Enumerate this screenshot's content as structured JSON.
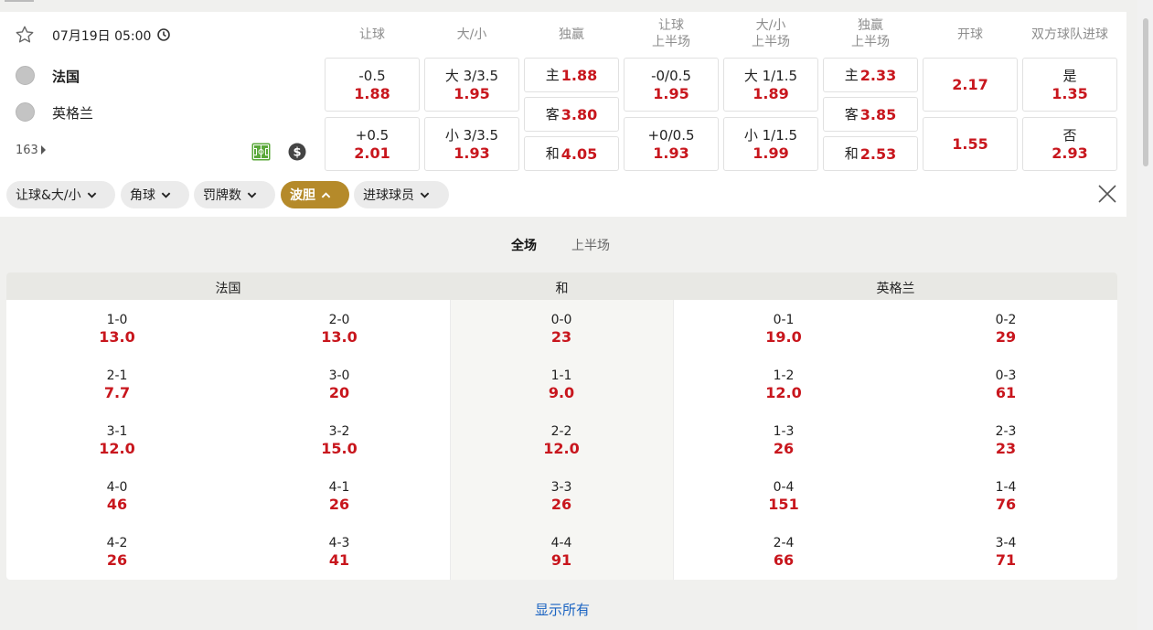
{
  "match": {
    "datetime": "07月19日 05:00",
    "home": "法国",
    "away": "英格兰",
    "more_count": "163"
  },
  "headers": [
    {
      "l1": "让球",
      "l2": ""
    },
    {
      "l1": "大/小",
      "l2": ""
    },
    {
      "l1": "独赢",
      "l2": ""
    },
    {
      "l1": "让球",
      "l2": "上半场"
    },
    {
      "l1": "大/小",
      "l2": "上半场"
    },
    {
      "l1": "独赢",
      "l2": "上半场"
    },
    {
      "l1": "开球",
      "l2": ""
    },
    {
      "l1": "双方球队进球",
      "l2": ""
    }
  ],
  "odds": {
    "handicap": [
      {
        "line": "-0.5",
        "odd": "1.88"
      },
      {
        "line": "+0.5",
        "odd": "2.01"
      }
    ],
    "over_under": [
      {
        "line": "大 3/3.5",
        "odd": "1.95"
      },
      {
        "line": "小 3/3.5",
        "odd": "1.93"
      }
    ],
    "moneyline": [
      {
        "label": "主",
        "odd": "1.88"
      },
      {
        "label": "客",
        "odd": "3.80"
      },
      {
        "label": "和",
        "odd": "4.05"
      }
    ],
    "handicap_1h": [
      {
        "line": "-0/0.5",
        "odd": "1.95"
      },
      {
        "line": "+0/0.5",
        "odd": "1.93"
      }
    ],
    "over_under_1h": [
      {
        "line": "大 1/1.5",
        "odd": "1.89"
      },
      {
        "line": "小 1/1.5",
        "odd": "1.99"
      }
    ],
    "moneyline_1h": [
      {
        "label": "主",
        "odd": "2.33"
      },
      {
        "label": "客",
        "odd": "3.85"
      },
      {
        "label": "和",
        "odd": "2.53"
      }
    ],
    "kickoff": [
      {
        "odd": "2.17"
      },
      {
        "odd": "1.55"
      }
    ],
    "btts": [
      {
        "label": "是",
        "odd": "1.35"
      },
      {
        "label": "否",
        "odd": "2.93"
      }
    ]
  },
  "filters": [
    "让球&大/小",
    "角球",
    "罚牌数",
    "波胆",
    "进球球员"
  ],
  "active_filter": "波胆",
  "tabs": [
    "全场",
    "上半场"
  ],
  "grid": {
    "headers": [
      "法国",
      "和",
      "英格兰"
    ],
    "home": [
      {
        "score": "1-0",
        "odd": "13.0"
      },
      {
        "score": "2-0",
        "odd": "13.0"
      },
      {
        "score": "2-1",
        "odd": "7.7"
      },
      {
        "score": "3-0",
        "odd": "20"
      },
      {
        "score": "3-1",
        "odd": "12.0"
      },
      {
        "score": "3-2",
        "odd": "15.0"
      },
      {
        "score": "4-0",
        "odd": "46"
      },
      {
        "score": "4-1",
        "odd": "26"
      },
      {
        "score": "4-2",
        "odd": "26"
      },
      {
        "score": "4-3",
        "odd": "41"
      }
    ],
    "draw": [
      {
        "score": "0-0",
        "odd": "23"
      },
      {
        "score": "1-1",
        "odd": "9.0"
      },
      {
        "score": "2-2",
        "odd": "12.0"
      },
      {
        "score": "3-3",
        "odd": "26"
      },
      {
        "score": "4-4",
        "odd": "91"
      }
    ],
    "away": [
      {
        "score": "0-1",
        "odd": "19.0"
      },
      {
        "score": "0-2",
        "odd": "29"
      },
      {
        "score": "1-2",
        "odd": "12.0"
      },
      {
        "score": "0-3",
        "odd": "61"
      },
      {
        "score": "1-3",
        "odd": "26"
      },
      {
        "score": "2-3",
        "odd": "23"
      },
      {
        "score": "0-4",
        "odd": "151"
      },
      {
        "score": "1-4",
        "odd": "76"
      },
      {
        "score": "2-4",
        "odd": "66"
      },
      {
        "score": "3-4",
        "odd": "71"
      }
    ]
  },
  "show_all": "显示所有"
}
